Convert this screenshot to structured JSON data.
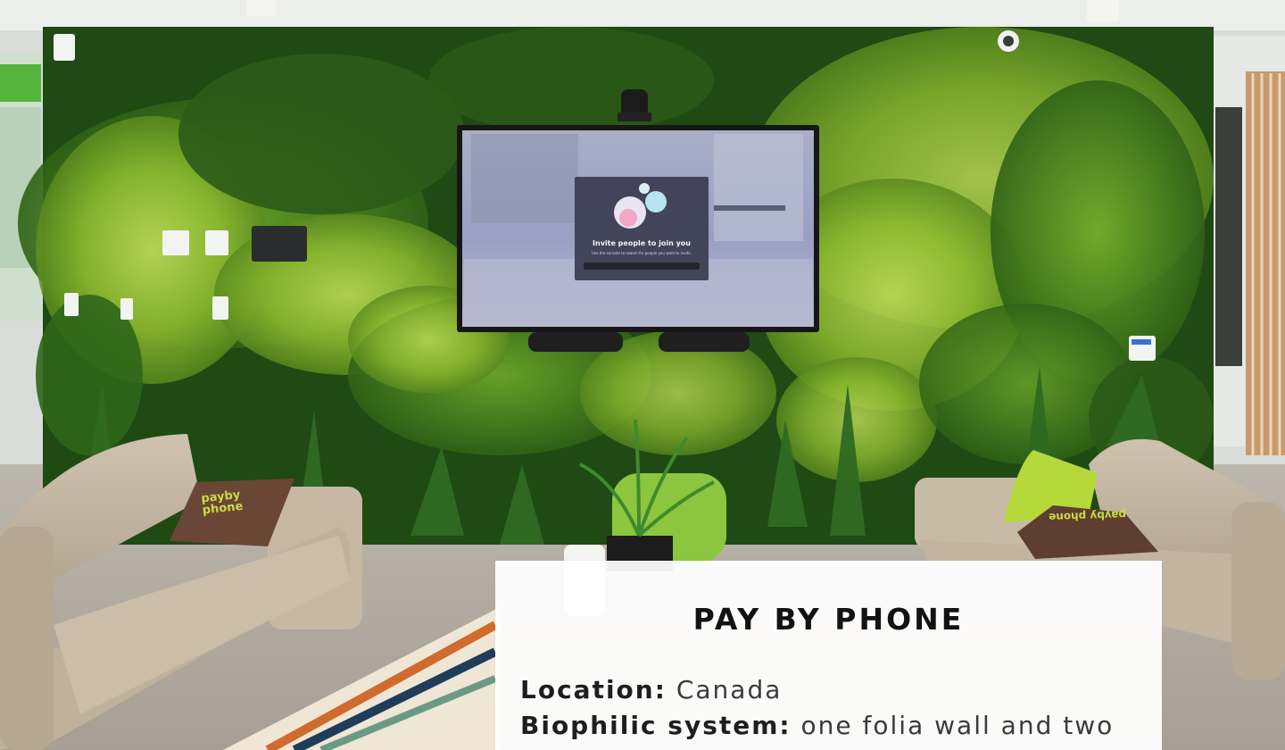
{
  "card": {
    "title": "PAY BY PHONE",
    "rows": [
      {
        "key": "Location:",
        "value": "Canada"
      },
      {
        "key": "Biophilic system:",
        "value": "one folia wall and two"
      }
    ]
  },
  "tv_screen": {
    "heading": "Invite people to join you",
    "subtext": "Use the console to search for people you want to invite."
  },
  "pillows": {
    "left": "payby phone",
    "right": "payby phone"
  },
  "colors": {
    "moss_dark": "#1f4a14",
    "moss_mid": "#3f7a1c",
    "moss_light": "#9cc23a",
    "sofa": "#c7b9a5",
    "pillow": "#6a4636",
    "ottoman": "#8cc63f"
  }
}
